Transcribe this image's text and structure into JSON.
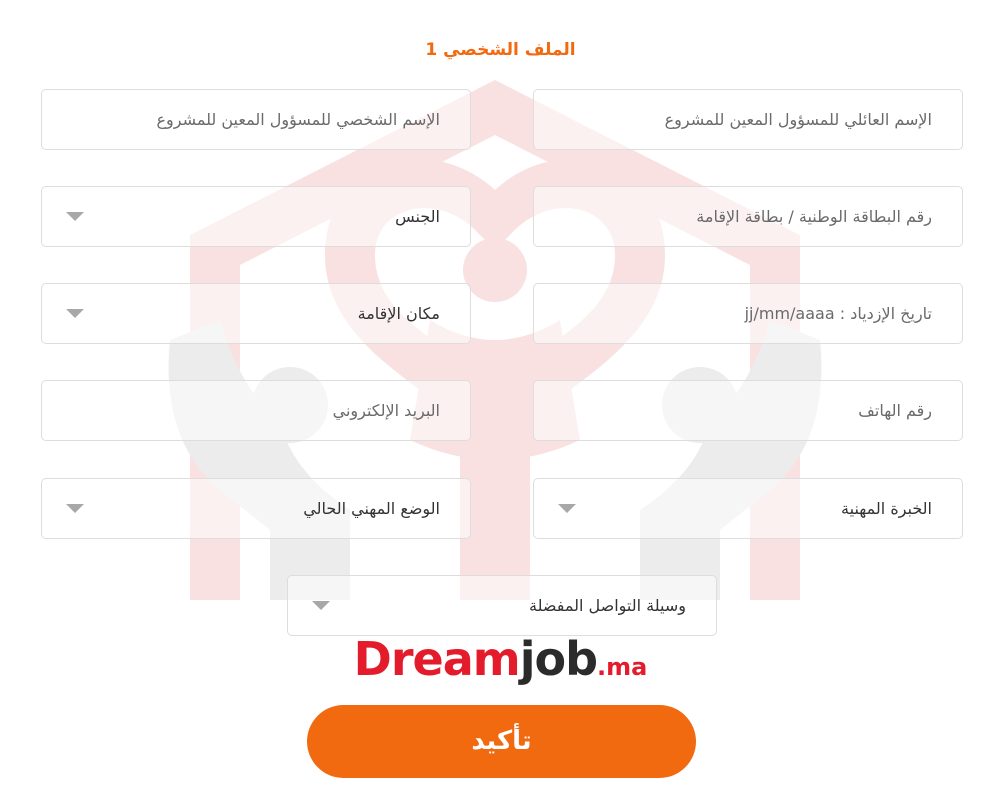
{
  "form": {
    "title": "الملف الشخصي 1",
    "fields": {
      "last_name": {
        "placeholder": "الإسم العائلي  للمسؤول المعين للمشروع"
      },
      "first_name": {
        "placeholder": "الإسم الشخصي للمسؤول المعين للمشروع"
      },
      "national_id": {
        "placeholder": "رقم البطاقة الوطنية / بطاقة الإقامة"
      },
      "gender": {
        "selected": "الجنس"
      },
      "birth_date": {
        "placeholder": "تاريخ الإزدياد : jj/mm/aaaa"
      },
      "residence": {
        "selected": "مكان الإقامة"
      },
      "phone": {
        "placeholder": "رقم الهاتف"
      },
      "email": {
        "placeholder": "البريد الإلكتروني"
      },
      "experience": {
        "selected": "الخبرة المهنية"
      },
      "job_status": {
        "selected": "الوضع المهني الحالي"
      },
      "contact_method": {
        "selected": "وسيلة التواصل المفضلة"
      }
    },
    "confirm_label": "تأكيد"
  },
  "logo": {
    "part1": "Dream",
    "part2": "job",
    "part3": ".ma"
  },
  "colors": {
    "accent": "#f26a10",
    "logo_red": "#e41b2b",
    "logo_dark": "#2b2b2b",
    "watermark_red": "#f7dcdc",
    "watermark_gray": "#e6e6e6"
  },
  "icons": {
    "caret": "caret-down-icon",
    "watermark": "people-in-house-logo"
  }
}
